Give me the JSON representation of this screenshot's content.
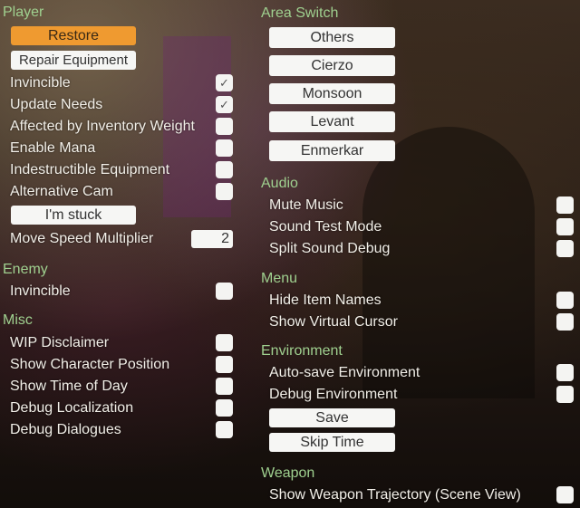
{
  "player": {
    "header": "Player",
    "restore": "Restore",
    "repair": "Repair Equipment",
    "toggles": [
      {
        "label": "Invincible",
        "checked": true
      },
      {
        "label": "Update Needs",
        "checked": true
      },
      {
        "label": "Affected by Inventory Weight",
        "checked": false
      },
      {
        "label": "Enable Mana",
        "checked": false
      },
      {
        "label": "Indestructible Equipment",
        "checked": false
      },
      {
        "label": "Alternative Cam",
        "checked": false
      }
    ],
    "stuck": "I'm stuck",
    "speed_label": "Move Speed Multiplier",
    "speed_value": "2"
  },
  "enemy": {
    "header": "Enemy",
    "toggles": [
      {
        "label": "Invincible",
        "checked": false
      }
    ]
  },
  "misc": {
    "header": "Misc",
    "toggles": [
      {
        "label": "WIP Disclaimer",
        "checked": false
      },
      {
        "label": "Show Character Position",
        "checked": false
      },
      {
        "label": "Show Time of Day",
        "checked": false
      },
      {
        "label": "Debug Localization",
        "checked": false
      },
      {
        "label": "Debug Dialogues",
        "checked": false
      }
    ]
  },
  "area_switch": {
    "header": "Area Switch",
    "buttons": [
      "Others",
      "Cierzo",
      "Monsoon",
      "Levant",
      "Enmerkar"
    ]
  },
  "audio": {
    "header": "Audio",
    "toggles": [
      {
        "label": "Mute Music",
        "checked": false
      },
      {
        "label": "Sound Test Mode",
        "checked": false
      },
      {
        "label": "Split Sound Debug",
        "checked": false
      }
    ]
  },
  "menu": {
    "header": "Menu",
    "toggles": [
      {
        "label": "Hide Item Names",
        "checked": false
      },
      {
        "label": "Show Virtual Cursor",
        "checked": false
      }
    ]
  },
  "environment": {
    "header": "Environment",
    "toggles": [
      {
        "label": "Auto-save Environment",
        "checked": false
      },
      {
        "label": "Debug Environment",
        "checked": false
      }
    ],
    "save": "Save",
    "skip_time": "Skip Time"
  },
  "weapon": {
    "header": "Weapon",
    "toggles": [
      {
        "label": "Show Weapon Trajectory (Scene View)",
        "checked": false
      }
    ]
  },
  "icons": {
    "check": "✓"
  },
  "colors": {
    "header": "#9fd08f",
    "accent_button": "#ef9a30"
  }
}
